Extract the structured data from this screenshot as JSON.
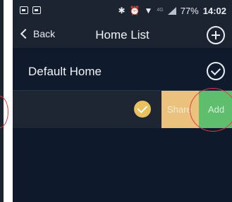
{
  "status_bar": {
    "battery": "77%",
    "time": "14:02",
    "network": "4G"
  },
  "header": {
    "back_label": "Back",
    "title": "Home List"
  },
  "homes": [
    {
      "name": "Default Home",
      "selected_icon": "check-circle-outline-icon"
    },
    {
      "name": "",
      "selected_icon": "check-circle-filled-icon"
    }
  ],
  "swipe_actions": {
    "share_label": "Share",
    "add_label": "Add"
  },
  "colors": {
    "background": "#0e1a2c",
    "bar": "#1b2430",
    "share": "#eac27d",
    "add": "#5fbe6e",
    "check_fill": "#e9c15e",
    "annotation": "#e23b3b"
  }
}
